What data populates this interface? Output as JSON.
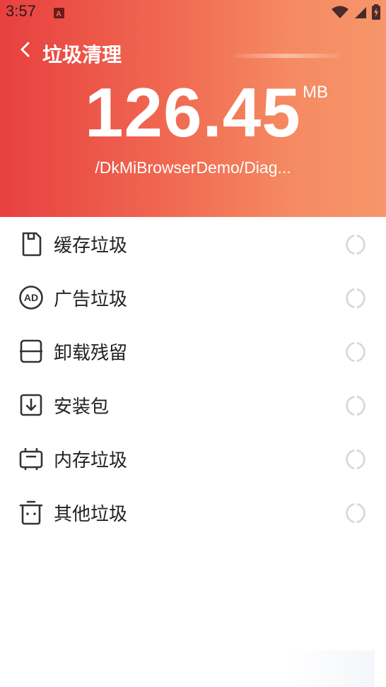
{
  "status_bar": {
    "time": "3:57"
  },
  "header": {
    "title": "垃圾清理",
    "size_value": "126.45",
    "size_unit": "MB",
    "scan_path": "/DkMiBrowserDemo/Diag...",
    "gradient_start": "#e8403f",
    "gradient_end": "#f6966a"
  },
  "items": [
    {
      "label": "缓存垃圾",
      "icon": "sd-card-icon"
    },
    {
      "label": "广告垃圾",
      "icon": "ad-icon"
    },
    {
      "label": "卸载残留",
      "icon": "uninstall-icon"
    },
    {
      "label": "安装包",
      "icon": "download-package-icon"
    },
    {
      "label": "内存垃圾",
      "icon": "memory-chip-icon"
    },
    {
      "label": "其他垃圾",
      "icon": "trash-icon"
    }
  ]
}
